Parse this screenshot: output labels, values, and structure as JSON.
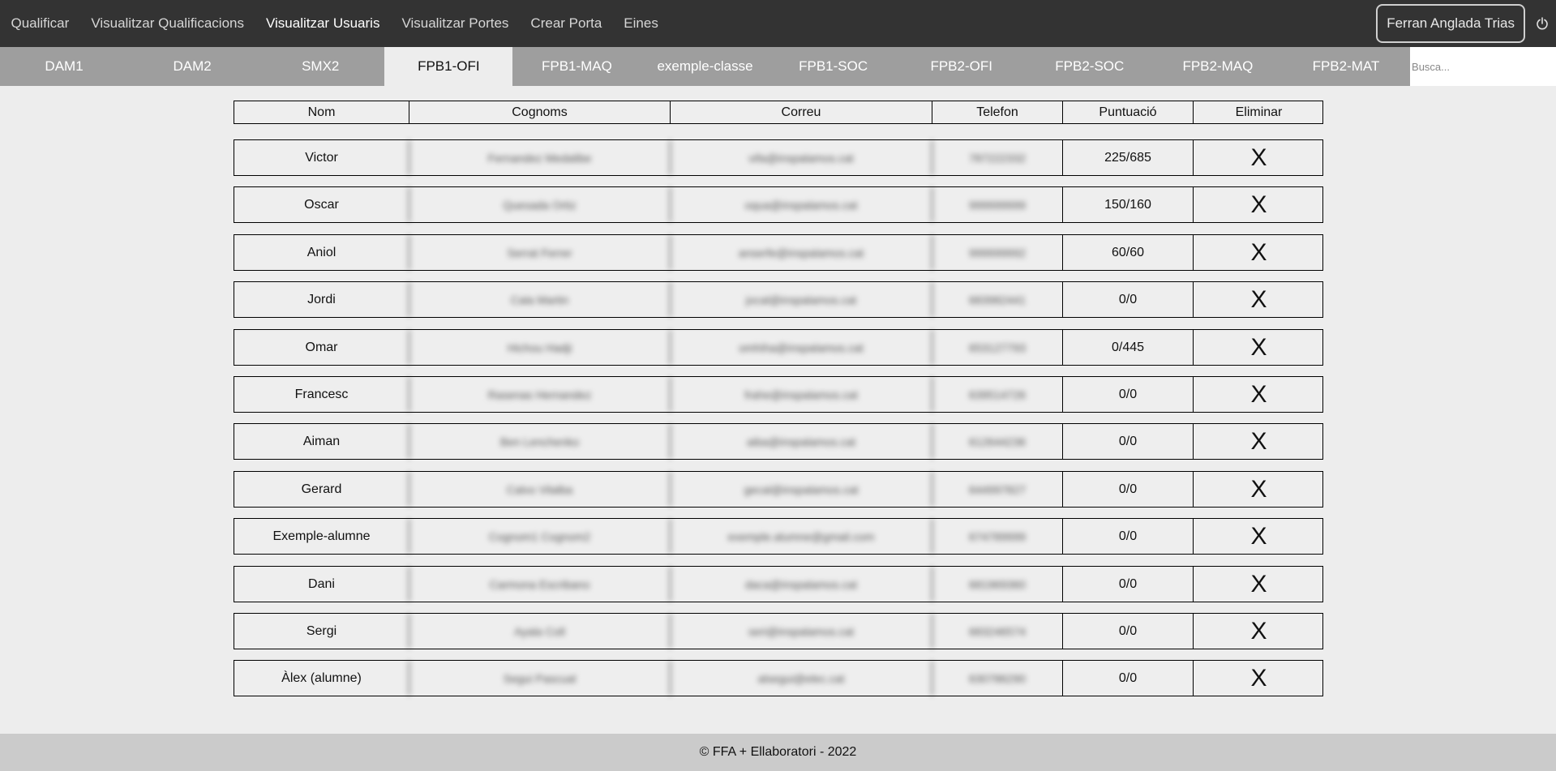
{
  "nav": {
    "items": [
      {
        "label": "Qualificar",
        "active": false
      },
      {
        "label": "Visualitzar Qualificacions",
        "active": false
      },
      {
        "label": "Visualitzar Usuaris",
        "active": true
      },
      {
        "label": "Visualitzar Portes",
        "active": false
      },
      {
        "label": "Crear Porta",
        "active": false
      },
      {
        "label": "Eines",
        "active": false
      }
    ],
    "user_name": "Ferran Anglada Trias",
    "power_icon": "power-icon"
  },
  "tabs": [
    {
      "label": "DAM1",
      "active": false
    },
    {
      "label": "DAM2",
      "active": false
    },
    {
      "label": "SMX2",
      "active": false
    },
    {
      "label": "FPB1-OFI",
      "active": true
    },
    {
      "label": "FPB1-MAQ",
      "active": false
    },
    {
      "label": "exemple-classe",
      "active": false
    },
    {
      "label": "FPB1-SOC",
      "active": false
    },
    {
      "label": "FPB2-OFI",
      "active": false
    },
    {
      "label": "FPB2-SOC",
      "active": false
    },
    {
      "label": "FPB2-MAQ",
      "active": false
    },
    {
      "label": "FPB2-MAT",
      "active": false
    }
  ],
  "search": {
    "placeholder": "Busca..."
  },
  "table": {
    "headers": [
      "Nom",
      "Cognoms",
      "Correu",
      "Telefon",
      "Puntuació",
      "Eliminar"
    ],
    "delete_symbol": "X",
    "rows": [
      {
        "nom": "Victor",
        "cognoms": "Fernandez Medalibe",
        "correu": "vifa@inspalamos.cat",
        "telefon": "787222332",
        "puntuacio": "225/685"
      },
      {
        "nom": "Oscar",
        "cognoms": "Quesada Ortiz",
        "correu": "oqua@inspalamos.cat",
        "telefon": "999999999",
        "puntuacio": "150/160"
      },
      {
        "nom": "Aniol",
        "cognoms": "Serrat Ferrer",
        "correu": "anserfe@inspalamos.cat",
        "telefon": "999999992",
        "puntuacio": "60/60"
      },
      {
        "nom": "Jordi",
        "cognoms": "Cala Martin",
        "correu": "jocal@inspalamos.cat",
        "telefon": "683982441",
        "puntuacio": "0/0"
      },
      {
        "nom": "Omar",
        "cognoms": "Hichou Hadji",
        "correu": "omhiha@inspalamos.cat",
        "telefon": "653127793",
        "puntuacio": "0/445"
      },
      {
        "nom": "Francesc",
        "cognoms": "Rasenas Hernandez",
        "correu": "frahe@inspalamos.cat",
        "telefon": "639514726",
        "puntuacio": "0/0"
      },
      {
        "nom": "Aiman",
        "cognoms": "Ben Lenchenko",
        "correu": "aiba@inspalamos.cat",
        "telefon": "612644236",
        "puntuacio": "0/0"
      },
      {
        "nom": "Gerard",
        "cognoms": "Calvo Vilalba",
        "correu": "gecal@inspalamos.cat",
        "telefon": "644997827",
        "puntuacio": "0/0"
      },
      {
        "nom": "Exemple-alumne",
        "cognoms": "Cognom1 Cognom2",
        "correu": "exemple.alumne@gmail.com",
        "telefon": "674789999",
        "puntuacio": "0/0"
      },
      {
        "nom": "Dani",
        "cognoms": "Carmona Escribano",
        "correu": "daca@inspalamos.cat",
        "telefon": "681969360",
        "puntuacio": "0/0"
      },
      {
        "nom": "Sergi",
        "cognoms": "Ayala Coll",
        "correu": "seri@inspalamos.cat",
        "telefon": "683246574",
        "puntuacio": "0/0"
      },
      {
        "nom": "Àlex (alumne)",
        "cognoms": "Segui Pascual",
        "correu": "alsegui@elec.cat",
        "telefon": "630786290",
        "puntuacio": "0/0"
      }
    ]
  },
  "footer": {
    "text": "© FFA + Ellaboratori - 2022"
  }
}
